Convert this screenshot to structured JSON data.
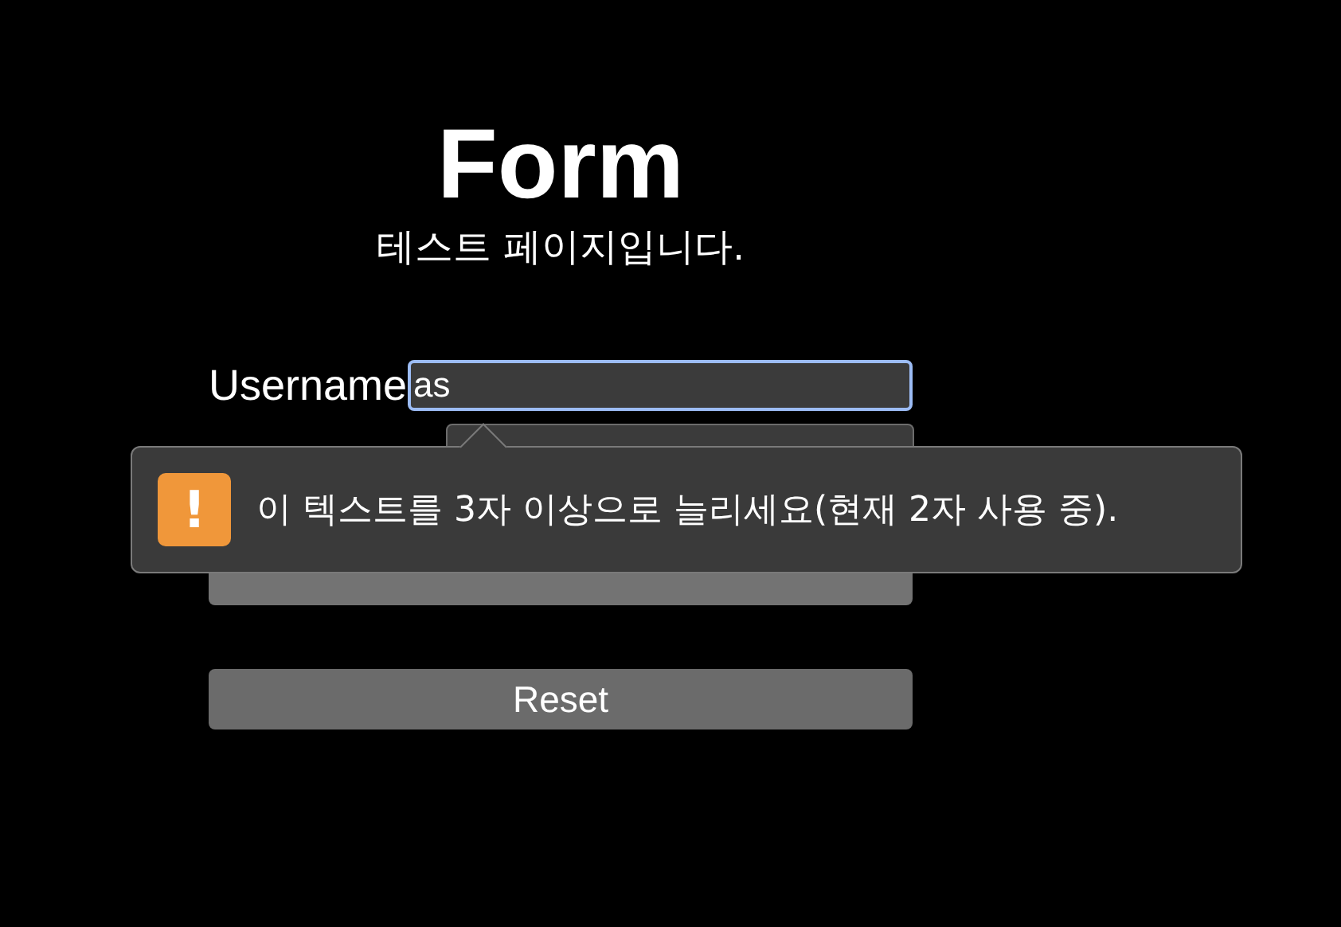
{
  "title": "Form",
  "subtitle": "테스트 페이지입니다.",
  "fields": [
    {
      "label": "Username",
      "value": "as",
      "focused": true
    },
    {
      "focused": false
    }
  ],
  "buttons": [
    {
      "kind": "submit"
    },
    {
      "kind": "reset",
      "label": "Reset"
    }
  ],
  "validation_tooltip": {
    "message": "이 텍스트를 3자 이상으로 늘리세요(현재 2자 사용 중).",
    "icon": "!"
  }
}
